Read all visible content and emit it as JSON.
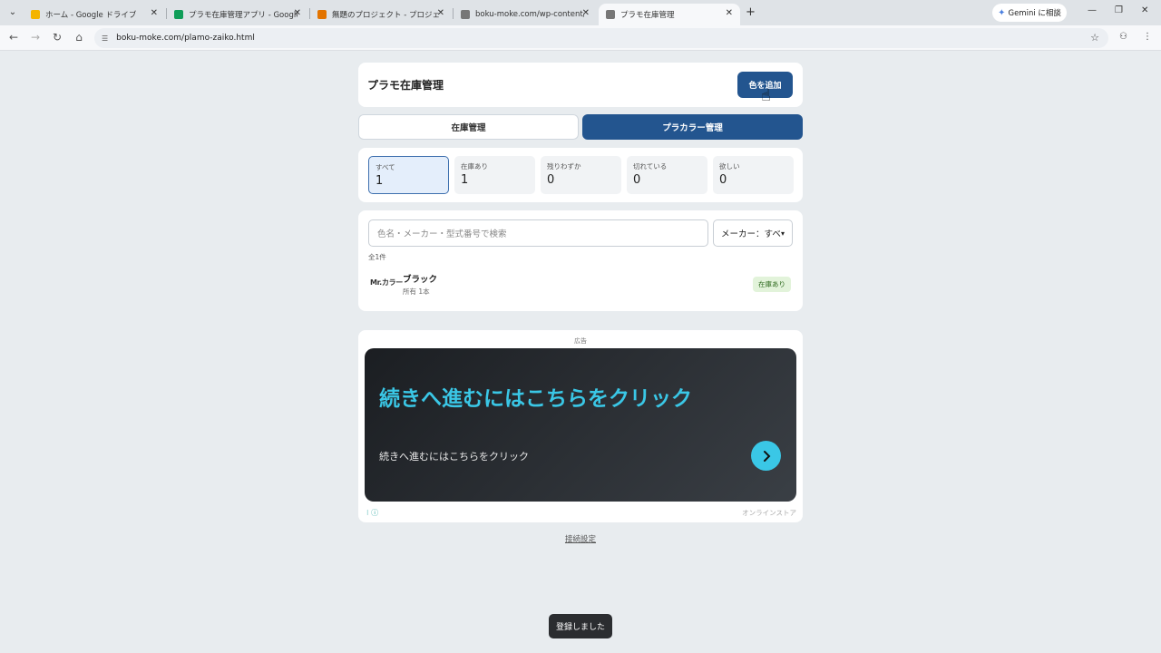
{
  "browser": {
    "tabs": [
      {
        "label": "ホーム - Google ドライブ",
        "color": "#f4b400"
      },
      {
        "label": "プラモ在庫管理アプリ - Google ス",
        "color": "#0f9d58"
      },
      {
        "label": "無題のプロジェクト - プロジェクト編",
        "color": "#e37400"
      },
      {
        "label": "boku-moke.com/wp-content/u",
        "color": "#777777"
      },
      {
        "label": "プラモ在庫管理",
        "color": "#777777"
      }
    ],
    "new_tab": "+",
    "gemini": "Gemini に相談",
    "url": "boku-moke.com/plamo-zaiko.html"
  },
  "header": {
    "title": "プラモ在庫管理",
    "add_button": "色を追加"
  },
  "main_tabs": {
    "inventory": "在庫管理",
    "palette": "プラカラー管理"
  },
  "stats": [
    {
      "label": "すべて",
      "value": "1"
    },
    {
      "label": "在庫あり",
      "value": "1"
    },
    {
      "label": "残りわずか",
      "value": "0"
    },
    {
      "label": "切れている",
      "value": "0"
    },
    {
      "label": "欲しい",
      "value": "0"
    }
  ],
  "search": {
    "placeholder": "色名・メーカー・型式番号で検索",
    "maker_filter": "メーカー：すべ"
  },
  "list": {
    "count": "全1件",
    "items": [
      {
        "brand": "Mr.カラー",
        "name": "ブラック",
        "owned": "所有 1本",
        "status": "在庫あり"
      }
    ]
  },
  "ad": {
    "label": "広告",
    "headline": "続きへ進むにはこちらをクリック",
    "subtext": "続きへ進むにはこちらをクリック",
    "source": "オンラインストア",
    "accent": "#3ac7e6"
  },
  "connection_settings": "接続設定",
  "toast": "登録しました",
  "colors": {
    "primary": "#23558f",
    "background": "#e8ecef"
  }
}
